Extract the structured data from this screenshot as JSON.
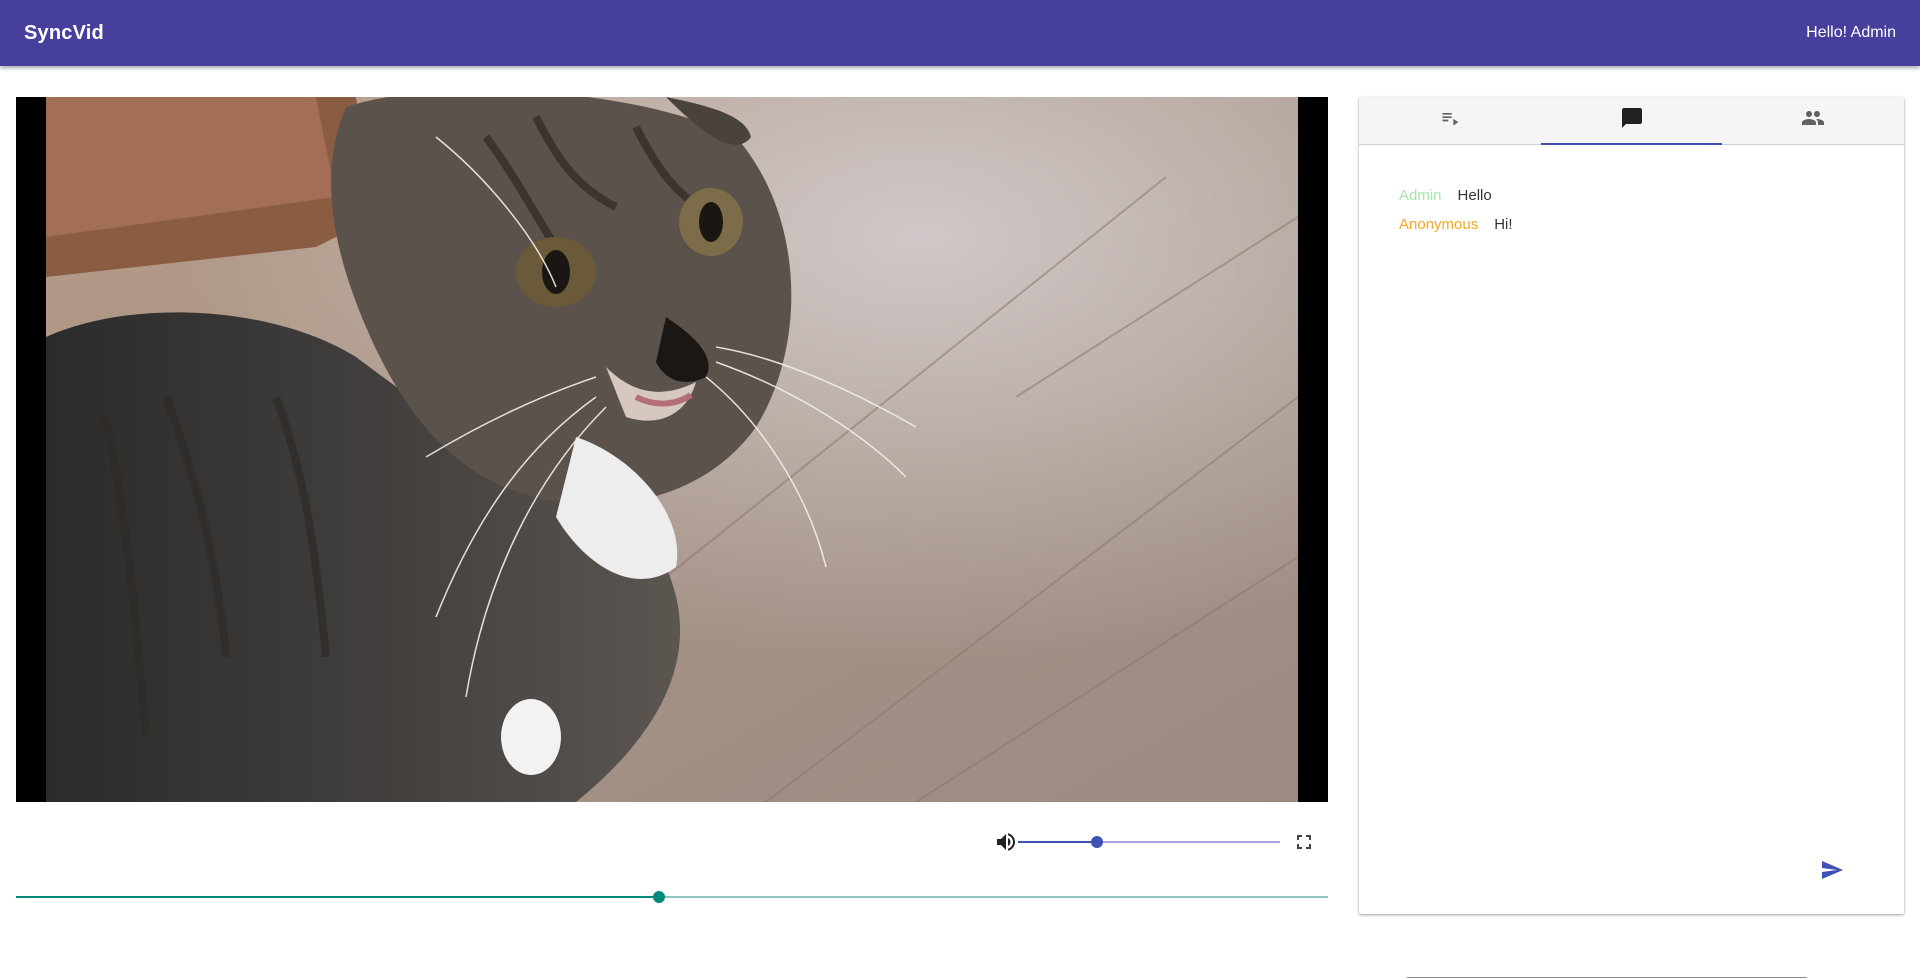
{
  "appbar": {
    "brand": "SyncVid",
    "greeting": "Hello! Admin",
    "color": "#463f9c"
  },
  "video": {
    "subject": "tabby cat on wooden floor"
  },
  "controls": {
    "volume_level": 0.3,
    "seek_progress": 0.49,
    "volume_color": "#3f51b5",
    "seek_color": "#00897b"
  },
  "panel": {
    "tabs": [
      {
        "icon": "playlist-icon",
        "active": false
      },
      {
        "icon": "chat-icon",
        "active": true
      },
      {
        "icon": "people-icon",
        "active": false
      }
    ],
    "messages": [
      {
        "author": "Admin",
        "text": "Hello",
        "color": "#a5e6a8"
      },
      {
        "author": "Anonymous",
        "text": "Hi!",
        "color": "#f5a623"
      }
    ],
    "chat_input": {
      "value": "",
      "placeholder": ""
    }
  }
}
